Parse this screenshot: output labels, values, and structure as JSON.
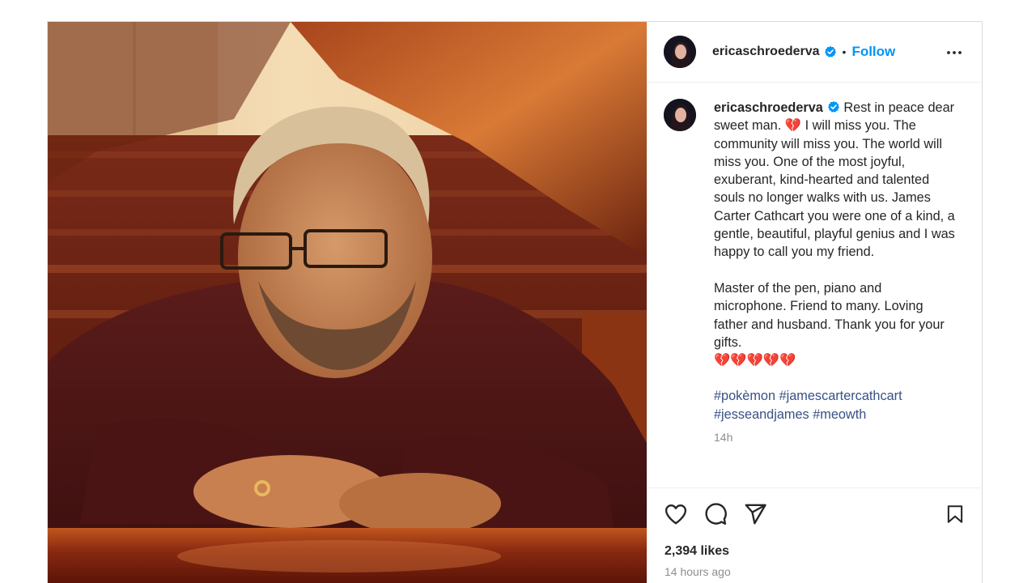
{
  "post": {
    "author": {
      "username": "ericaschroederva",
      "verified": true,
      "avatar_icon": "profile-photo"
    },
    "header": {
      "separator": "•",
      "follow_label": "Follow",
      "more_icon": "more-options-icon"
    },
    "caption": {
      "username": "ericaschroederva",
      "text": " Rest in peace dear sweet man. 💔 I will miss you. The community will miss you. The world will miss you. One of the most joyful, exuberant, kind-hearted and talented souls no longer walks with us. James Carter Cathcart you were one of a kind, a gentle, beautiful, playful genius and I was happy to call you my friend.\n\nMaster of the pen, piano and microphone. Friend to many. Loving father and husband. Thank you for your gifts.\n💔💔💔💔💔",
      "hashtags": [
        "#pokèmon",
        "#jamescartercathcart",
        "#jesseandjames",
        "#meowth"
      ],
      "time": "14h"
    },
    "likes": "2,394 likes",
    "posted_ago": "14 hours ago",
    "colors": {
      "accent": "#0095f6",
      "hashtag": "#385185",
      "muted": "#8e8e8e",
      "verified": "#0095f6"
    }
  }
}
